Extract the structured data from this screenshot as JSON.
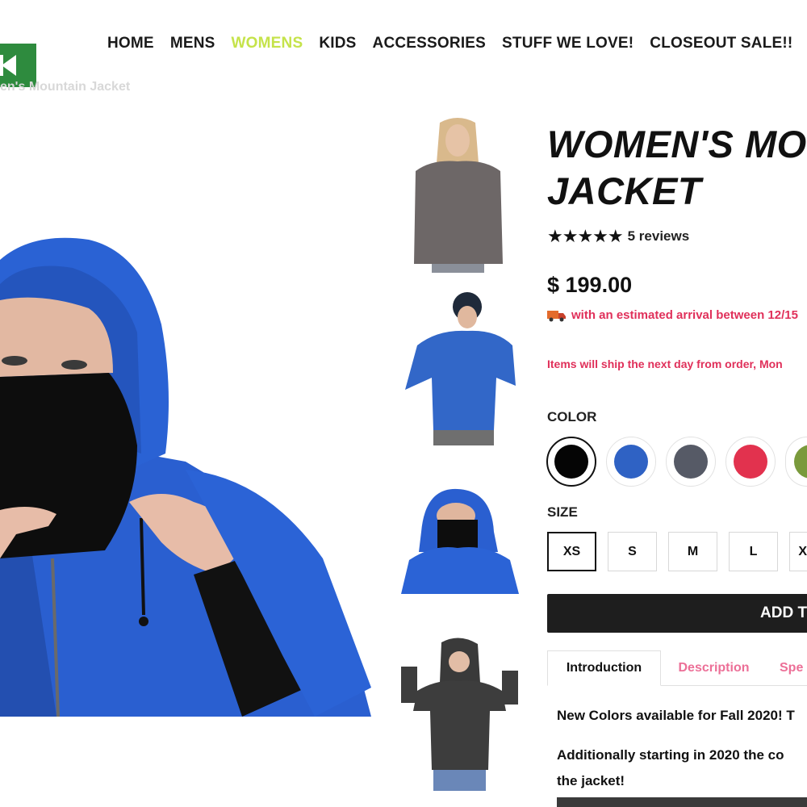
{
  "nav": {
    "items": [
      {
        "label": "HOME",
        "active": false
      },
      {
        "label": "MENS",
        "active": false
      },
      {
        "label": "WOMENS",
        "active": true
      },
      {
        "label": "KIDS",
        "active": false
      },
      {
        "label": "ACCESSORIES",
        "active": false
      },
      {
        "label": "STUFF WE LOVE!",
        "active": false
      },
      {
        "label": "CLOSEOUT SALE!!",
        "active": false
      }
    ],
    "active_color": "#c5e34a"
  },
  "breadcrumb": "en's Mountain Jacket",
  "product": {
    "title_line1": "WOMEN'S MO",
    "title_line2": "JACKET",
    "stars": "★★★★★",
    "reviews": "5 reviews",
    "price": "$ 199.00",
    "shipping_estimate": "with an estimated arrival between 12/15",
    "shipping_note": "Items will ship the next day from order, Mon",
    "truck_icon": "truck-icon"
  },
  "options": {
    "color_label": "COLOR",
    "colors": [
      {
        "name": "black",
        "hex": "#050505",
        "selected": true
      },
      {
        "name": "blue",
        "hex": "#2f62c4",
        "selected": false
      },
      {
        "name": "charcoal",
        "hex": "#565a66",
        "selected": false
      },
      {
        "name": "red",
        "hex": "#e2324e",
        "selected": false
      },
      {
        "name": "olive",
        "hex": "#7a9a3c",
        "selected": false
      }
    ],
    "size_label": "SIZE",
    "sizes": [
      {
        "label": "XS",
        "selected": true
      },
      {
        "label": "S",
        "selected": false
      },
      {
        "label": "M",
        "selected": false
      },
      {
        "label": "L",
        "selected": false
      },
      {
        "label": "X",
        "selected": false
      }
    ]
  },
  "add_to_cart": "ADD T",
  "tabs": [
    {
      "label": "Introduction",
      "active": true
    },
    {
      "label": "Description",
      "active": false
    },
    {
      "label": "Spe",
      "active": false
    }
  ],
  "content": {
    "line1": "New Colors available for Fall 2020! T",
    "line2": "Additionally starting in 2020 the co",
    "line3": "the jacket!"
  },
  "colors": {
    "logo_green": "#2e8b3e",
    "accent_pink": "#e0305a",
    "tab_pink": "#ec6f97",
    "button_dark": "#1e1e1e"
  }
}
